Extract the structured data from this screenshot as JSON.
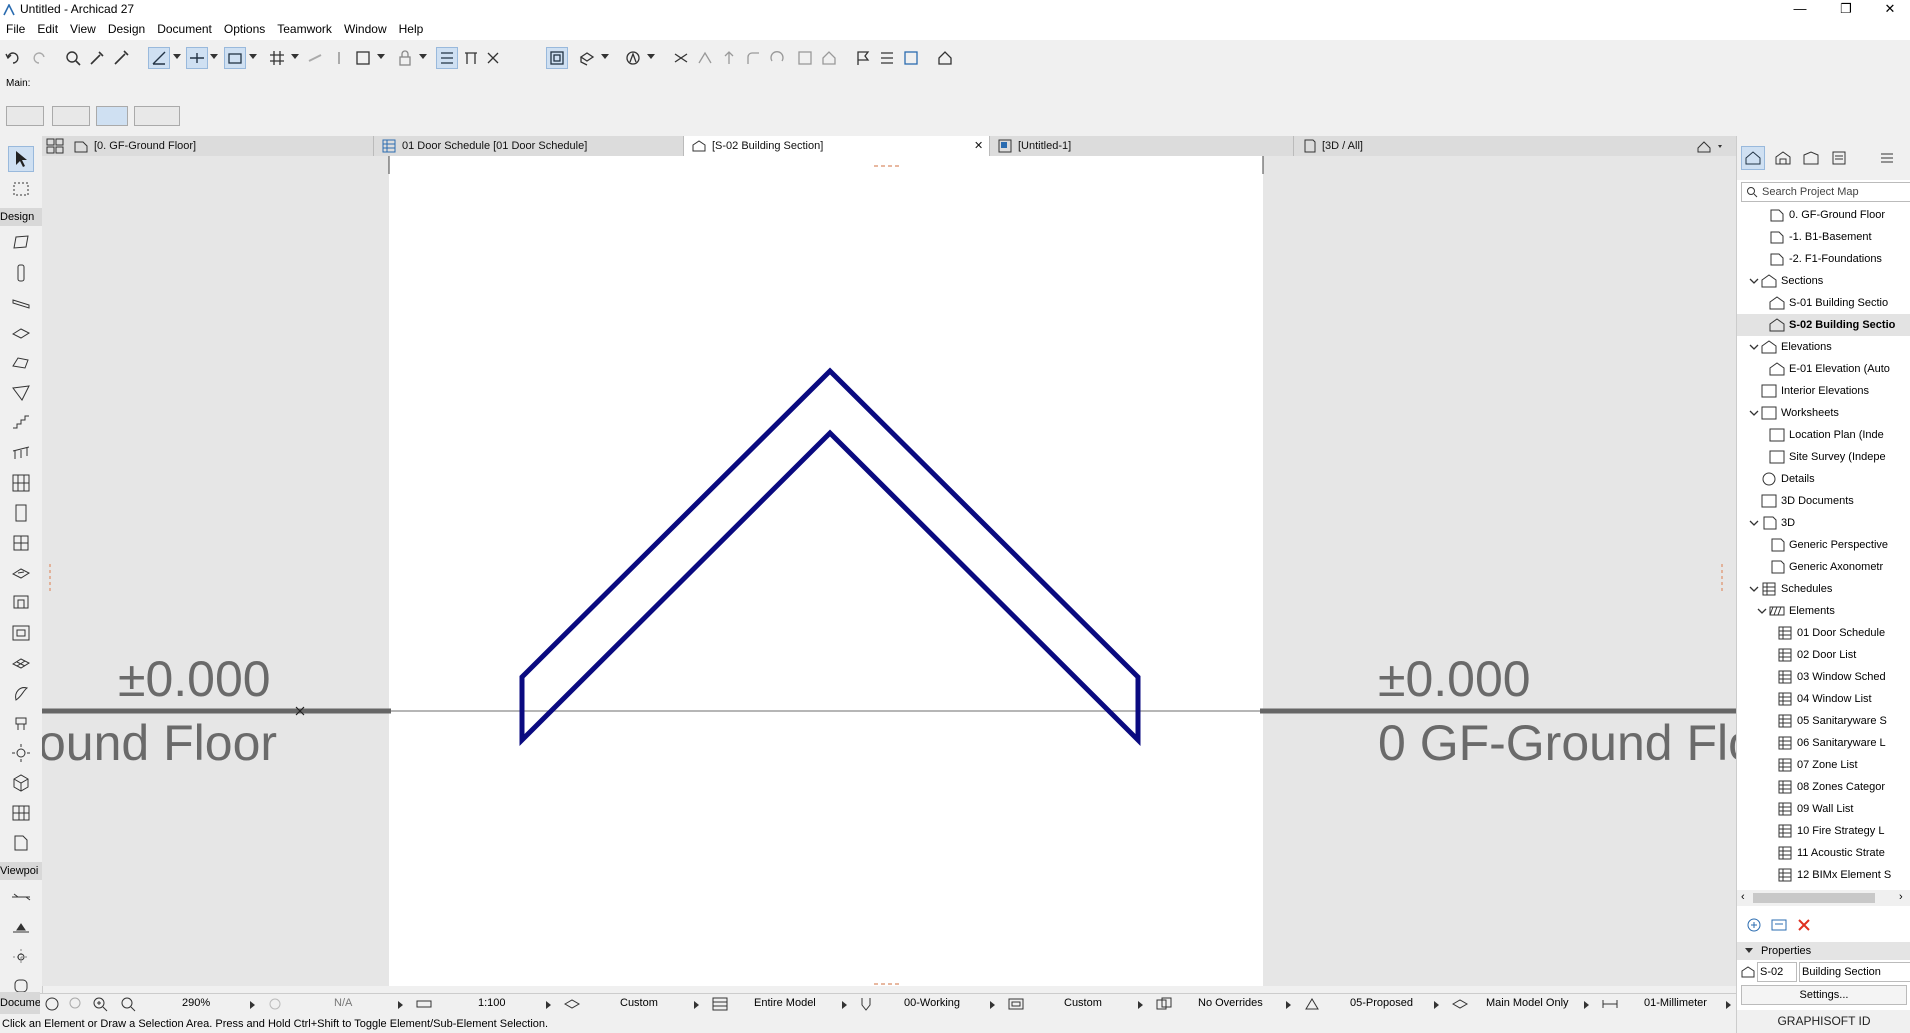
{
  "window": {
    "title": "Untitled - Archicad 27",
    "controls": [
      "—",
      "❐",
      "✕"
    ]
  },
  "menu": [
    "File",
    "Edit",
    "View",
    "Design",
    "Document",
    "Options",
    "Teamwork",
    "Window",
    "Help"
  ],
  "infobox": {
    "label": "Main:"
  },
  "tabs": [
    {
      "label": "[0. GF-Ground Floor]",
      "icon": "floor-plan-icon"
    },
    {
      "label": "01 Door Schedule [01 Door Schedule]",
      "icon": "schedule-icon"
    },
    {
      "label": "[S-02 Building Section]",
      "icon": "section-icon",
      "active": true,
      "close": "✕"
    },
    {
      "label": "[Untitled-1]",
      "icon": "layout-icon"
    },
    {
      "label": "[3D / All]",
      "icon": "3d-icon"
    }
  ],
  "toolbox": {
    "sections": [
      "Design",
      "Viewpoi",
      "Docume"
    ]
  },
  "canvas": {
    "level_left": "±0.000",
    "floor_left": "ound Floor",
    "level_right": "±0.000",
    "floor_right": "0 GF-Ground Flo",
    "roof_color": "#0a0a80"
  },
  "status_row": {
    "zoom": "290%",
    "angle": "N/A",
    "scale": "1:100",
    "layer_combo": "Custom",
    "model": "Entire Model",
    "pen_set": "00-Working",
    "model_view": "Custom",
    "overrides": "No Overrides",
    "renovation": "05-Proposed",
    "structure": "Main Model Only",
    "dimension": "01-Millimeter"
  },
  "statusbar": {
    "message": "Click an Element or Draw a Selection Area. Press and Hold Ctrl+Shift to Toggle Element/Sub-Element Selection."
  },
  "navigator": {
    "search_placeholder": "Search Project Map",
    "tree": [
      {
        "label": "0. GF-Ground Floor",
        "indent": 2,
        "icon": "story-icon"
      },
      {
        "label": "-1. B1-Basement",
        "indent": 2,
        "icon": "story-icon"
      },
      {
        "label": "-2. F1-Foundations",
        "indent": 2,
        "icon": "story-icon"
      },
      {
        "label": "Sections",
        "indent": 1,
        "icon": "section-icon",
        "expanded": true
      },
      {
        "label": "S-01 Building Sectio",
        "indent": 2,
        "icon": "section-icon"
      },
      {
        "label": "S-02 Building Sectio",
        "indent": 2,
        "icon": "section-icon",
        "selected": true
      },
      {
        "label": "Elevations",
        "indent": 1,
        "icon": "elevation-icon",
        "expanded": true
      },
      {
        "label": "E-01 Elevation (Auto",
        "indent": 2,
        "icon": "elevation-icon"
      },
      {
        "label": "Interior Elevations",
        "indent": 1,
        "icon": "interior-elevation-icon"
      },
      {
        "label": "Worksheets",
        "indent": 1,
        "icon": "worksheet-icon",
        "expanded": true
      },
      {
        "label": "Location Plan (Inde",
        "indent": 2,
        "icon": "worksheet-icon"
      },
      {
        "label": "Site Survey (Indepe",
        "indent": 2,
        "icon": "worksheet-icon"
      },
      {
        "label": "Details",
        "indent": 1,
        "icon": "details-icon"
      },
      {
        "label": "3D Documents",
        "indent": 1,
        "icon": "3d-document-icon"
      },
      {
        "label": "3D",
        "indent": 1,
        "icon": "3d-icon",
        "expanded": true
      },
      {
        "label": "Generic Perspective",
        "indent": 2,
        "icon": "perspective-icon"
      },
      {
        "label": "Generic Axonometr",
        "indent": 2,
        "icon": "axonometry-icon"
      },
      {
        "label": "Schedules",
        "indent": 1,
        "icon": "schedule-icon",
        "expanded": true
      },
      {
        "label": "Elements",
        "indent": 2,
        "icon": "elements-icon",
        "expanded": true
      },
      {
        "label": "01 Door Schedule",
        "indent": 3,
        "icon": "schedule-icon"
      },
      {
        "label": "02 Door List",
        "indent": 3,
        "icon": "schedule-icon"
      },
      {
        "label": "03 Window Sched",
        "indent": 3,
        "icon": "schedule-icon"
      },
      {
        "label": "04 Window List",
        "indent": 3,
        "icon": "schedule-icon"
      },
      {
        "label": "05 Sanitaryware S",
        "indent": 3,
        "icon": "schedule-icon"
      },
      {
        "label": "06 Sanitaryware L",
        "indent": 3,
        "icon": "schedule-icon"
      },
      {
        "label": "07 Zone List",
        "indent": 3,
        "icon": "schedule-icon"
      },
      {
        "label": "08 Zones Categor",
        "indent": 3,
        "icon": "schedule-icon"
      },
      {
        "label": "09 Wall List",
        "indent": 3,
        "icon": "schedule-icon"
      },
      {
        "label": "10 Fire Strategy L",
        "indent": 3,
        "icon": "schedule-icon"
      },
      {
        "label": "11 Acoustic Strate",
        "indent": 3,
        "icon": "schedule-icon"
      },
      {
        "label": "12 BIMx Element S",
        "indent": 3,
        "icon": "schedule-icon"
      }
    ],
    "properties_label": "Properties",
    "prop_id": "S-02",
    "prop_name": "Building Section",
    "settings_label": "Settings...",
    "brand": "GRAPHISOFT ID"
  }
}
